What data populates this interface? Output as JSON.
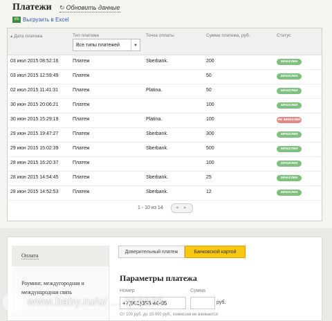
{
  "header": {
    "title": "Платежи",
    "refresh_label": "Обновить данные",
    "excel_label": "Выгрузить в Excel",
    "excel_icon": "excel-icon"
  },
  "table": {
    "columns": [
      "Дата платежа",
      "Тип платежа",
      "Точка оплаты",
      "Сумма платежа, руб.",
      "Статус"
    ],
    "filter_value": "Все типы платежей",
    "rows": [
      {
        "date": "03 июл 2015 08:52:16",
        "type": "Платеж",
        "point": "Sberbank.",
        "sum": "200",
        "status": "зачислен",
        "ok": true
      },
      {
        "date": "03 июл 2015 12:59:49",
        "type": "Платеж",
        "point": "",
        "sum": "50",
        "status": "зачислен",
        "ok": true
      },
      {
        "date": "02 июл 2015 11:41:31",
        "type": "Платеж",
        "point": "Platina.",
        "sum": "50",
        "status": "зачислен",
        "ok": true
      },
      {
        "date": "30 июн 2015 20:06:21",
        "type": "Платеж",
        "point": "",
        "sum": "100",
        "status": "зачислен",
        "ok": true
      },
      {
        "date": "30 июн 2015 15:29:19",
        "type": "Платеж",
        "point": "Platina.",
        "sum": "100",
        "status": "не зачислен",
        "ok": false
      },
      {
        "date": "29 июн 2015 19:47:27",
        "type": "Платеж",
        "point": "Sberbank.",
        "sum": "300",
        "status": "зачислен",
        "ok": true
      },
      {
        "date": "29 июн 2015 15:02:39",
        "type": "Платеж",
        "point": "Sberbank.",
        "sum": "500",
        "status": "зачислен",
        "ok": true
      },
      {
        "date": "28 июн 2015 16:20:37",
        "type": "Платеж",
        "point": "",
        "sum": "100",
        "status": "зачислен",
        "ok": true
      },
      {
        "date": "28 июн 2015 14:54:45",
        "type": "Платеж",
        "point": "Sberbank.",
        "sum": "25",
        "status": "зачислен",
        "ok": true
      },
      {
        "date": "28 июн 2015 14:52:53",
        "type": "Платеж",
        "point": "Sberbank.",
        "sum": "12",
        "status": "зачислен",
        "ok": true
      }
    ],
    "pager_text": "1 - 10 из 14"
  },
  "payment": {
    "sidebar": [
      "Оплата",
      "Роуминг, междугородная и международная связь"
    ],
    "tabs": [
      "Доверительный платеж",
      "Банковской картой"
    ],
    "title": "Параметры платежа",
    "number_label": "Номер",
    "sum_label": "Сумма",
    "number_value": "+7(901)383-44-05",
    "sum_unit": "руб.",
    "note": "От 100 руб. до 15 000 руб., комиссия не взимается"
  },
  "watermark": "www.baby.ru/u/ ... 358228",
  "colors": {
    "ok": "#7fbf7f",
    "bad": "#e08a8a",
    "tab_active": "#f9c712",
    "link": "#2a5db0"
  }
}
